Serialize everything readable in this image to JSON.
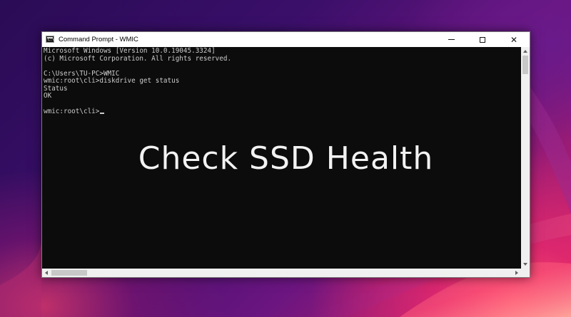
{
  "window": {
    "title": "Command Prompt - WMIC",
    "controls": {
      "minimize_icon": "minimize-icon",
      "maximize_icon": "maximize-icon",
      "close_icon": "close-icon",
      "close_glyph": "✕"
    }
  },
  "console": {
    "lines": [
      "Microsoft Windows [Version 10.0.19045.3324]",
      "(c) Microsoft Corporation. All rights reserved.",
      "",
      "C:\\Users\\TU-PC>WMIC",
      "wmic:root\\cli>diskdrive get status",
      "Status",
      "OK",
      "",
      "wmic:root\\cli>"
    ],
    "text_color": "#cccccc",
    "background_color": "#0c0c0c"
  },
  "overlay": {
    "headline": "Check SSD Health"
  },
  "app_icon": {
    "name": "command-prompt-icon",
    "glyph": "C:\\"
  }
}
